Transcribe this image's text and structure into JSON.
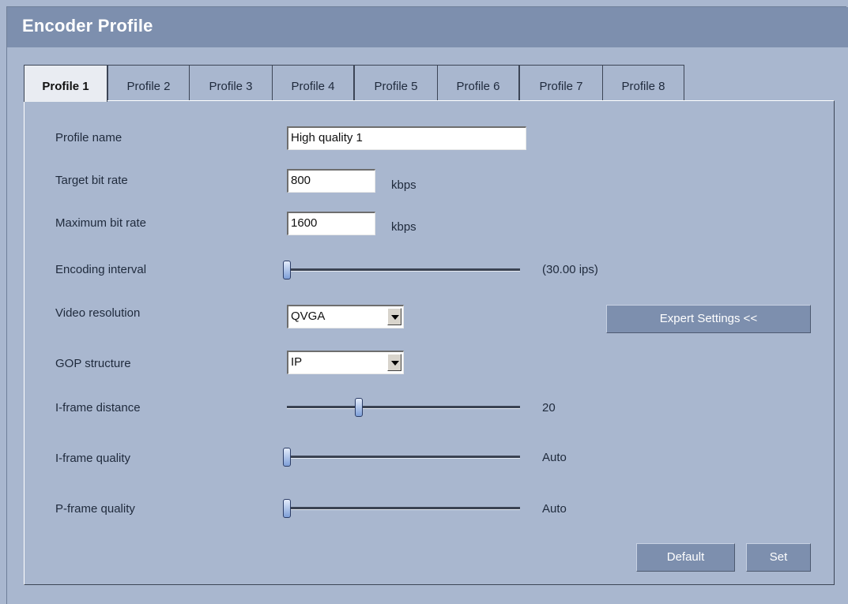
{
  "header": {
    "title": "Encoder Profile"
  },
  "tabs": [
    "Profile 1",
    "Profile 2",
    "Profile 3",
    "Profile 4",
    "Profile 5",
    "Profile 6",
    "Profile 7",
    "Profile 8"
  ],
  "active_tab": "Profile 1",
  "form": {
    "profile_name": {
      "label": "Profile name",
      "value": "High quality 1"
    },
    "target_bit_rate": {
      "label": "Target bit rate",
      "value": "800",
      "unit": "kbps"
    },
    "maximum_bit_rate": {
      "label": "Maximum bit rate",
      "value": "1600",
      "unit": "kbps"
    },
    "encoding_interval": {
      "label": "Encoding interval",
      "readout": "(30.00 ips)",
      "level": 0
    },
    "video_resolution": {
      "label": "Video resolution",
      "value": "QVGA"
    },
    "gop_structure": {
      "label": "GOP structure",
      "value": "IP"
    },
    "i_frame_distance": {
      "label": "I-frame distance",
      "readout": "20",
      "level": 0.31
    },
    "i_frame_quality": {
      "label": "I-frame quality",
      "readout": "Auto",
      "level": 0
    },
    "p_frame_quality": {
      "label": "P-frame quality",
      "readout": "Auto",
      "level": 0
    }
  },
  "buttons": {
    "expert_settings": "Expert Settings <<",
    "default": "Default",
    "set": "Set"
  },
  "colors": {
    "background": "#a9b7cf",
    "titlebar": "#7d8fae",
    "button": "#7d8fae",
    "active_tab": "#e9ecf2"
  }
}
